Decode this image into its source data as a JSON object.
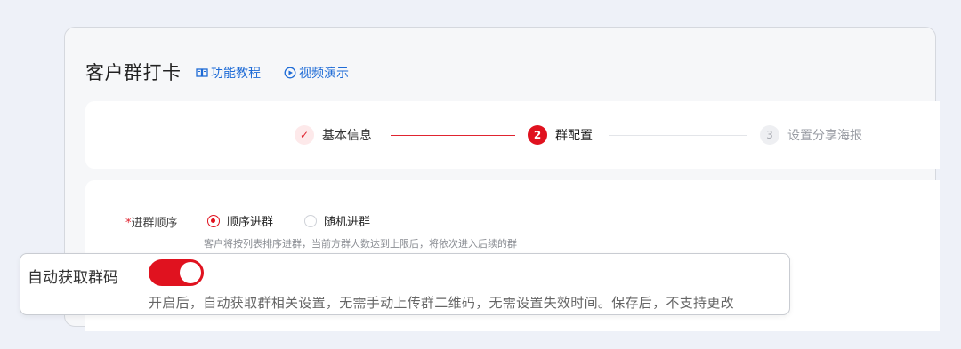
{
  "header": {
    "title": "客户群打卡",
    "links": [
      {
        "label": "功能教程",
        "icon": "book-icon"
      },
      {
        "label": "视频演示",
        "icon": "play-circle-icon"
      }
    ]
  },
  "steps": [
    {
      "index": "✓",
      "label": "基本信息",
      "state": "done"
    },
    {
      "index": "2",
      "label": "群配置",
      "state": "active"
    },
    {
      "index": "3",
      "label": "设置分享海报",
      "state": "pending"
    }
  ],
  "join_order": {
    "required_mark": "*",
    "label": "进群顺序",
    "options": [
      {
        "label": "顺序进群",
        "selected": true
      },
      {
        "label": "随机进群",
        "selected": false
      }
    ],
    "hint": "客户将按列表排序进群，当前方群人数达到上限后，将依次进入后续的群"
  },
  "auto_qr": {
    "label": "自动获取群码",
    "enabled": true,
    "description": "开启后，自动获取群相关设置，无需手动上传群二维码，无需设置失效时间。保存后，不支持更改"
  },
  "colors": {
    "accent": "#e0121f",
    "link": "#1e6bd6",
    "page_bg": "#eef1f8"
  }
}
